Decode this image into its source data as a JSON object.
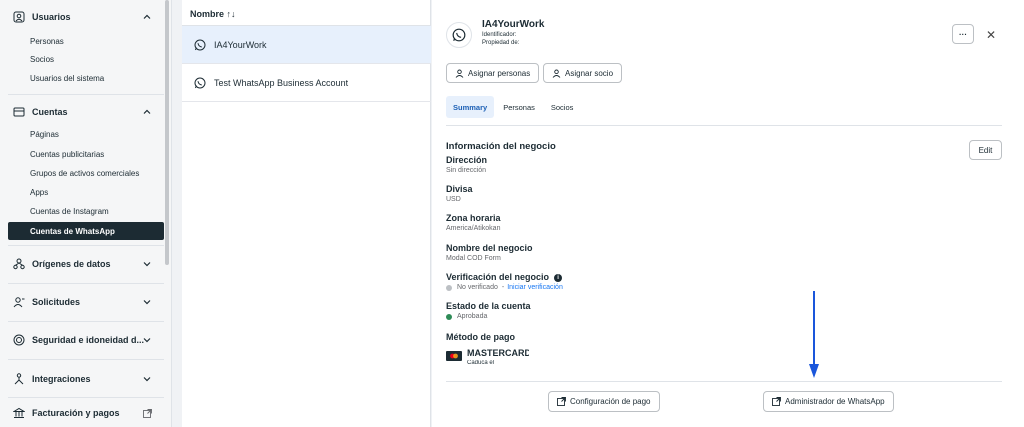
{
  "sidebar": {
    "sections": [
      {
        "label": "Usuarios",
        "icon": "users-icon",
        "chevron": "up"
      },
      {
        "label": "Cuentas",
        "icon": "wallet-icon",
        "chevron": "up"
      },
      {
        "label": "Orígenes de datos",
        "icon": "data-sources-icon",
        "chevron": "down"
      },
      {
        "label": "Solicitudes",
        "icon": "user-request-icon",
        "chevron": "down"
      },
      {
        "label": "Seguridad e idoneidad d...",
        "icon": "shield-icon",
        "chevron": "down"
      },
      {
        "label": "Integraciones",
        "icon": "integrations-icon",
        "chevron": "down"
      },
      {
        "label": "Facturación y pagos",
        "icon": "bank-icon",
        "chevron": "external"
      }
    ],
    "usuarios_items": [
      "Personas",
      "Socios",
      "Usuarios del sistema"
    ],
    "cuentas_items": [
      "Páginas",
      "Cuentas publicitarias",
      "Grupos de activos comerciales",
      "Apps",
      "Cuentas de Instagram",
      "Cuentas de WhatsApp"
    ],
    "active_item": "Cuentas de WhatsApp"
  },
  "list": {
    "header": "Nombre ↑↓",
    "rows": [
      "IA4YourWork",
      "Test WhatsApp Business Account"
    ]
  },
  "detail": {
    "title": "IA4YourWork",
    "id_label": "Identificador:",
    "owner_label": "Propiedad de:",
    "more_label": "···",
    "close_label": "✕",
    "assign_people": "Asignar personas",
    "assign_partner": "Asignar socio",
    "tabs": [
      "Summary",
      "Personas",
      "Socios"
    ],
    "section_title": "Información del negocio",
    "edit_label": "Edit",
    "fields": {
      "address_label": "Dirección",
      "address_value": "Sin dirección",
      "currency_label": "Divisa",
      "currency_value": "USD",
      "timezone_label": "Zona horaria",
      "timezone_value": "America/Atikokan",
      "business_name_label": "Nombre del negocio",
      "business_name_value": "Modal COD Form",
      "verification_label": "Verificación del negocio",
      "verification_value": "No verificado",
      "verification_separator": "-",
      "verification_link": "Iniciar verificación",
      "account_status_label": "Estado de la cuenta",
      "account_status_value": "Aprobada",
      "payment_label": "Método de pago",
      "card_name": "MASTERCARD",
      "card_expiry": "Caduca el"
    },
    "payment_config_button": "Configuración de pago",
    "wa_manager_button": "Administrador de WhatsApp"
  },
  "colors": {
    "active_bg": "#1c2b33",
    "selected_row": "#e7f0fc",
    "link": "#1877f2",
    "approved": "#2e8b57",
    "unverified": "#bcc0c4",
    "arrow": "#1a56db"
  }
}
